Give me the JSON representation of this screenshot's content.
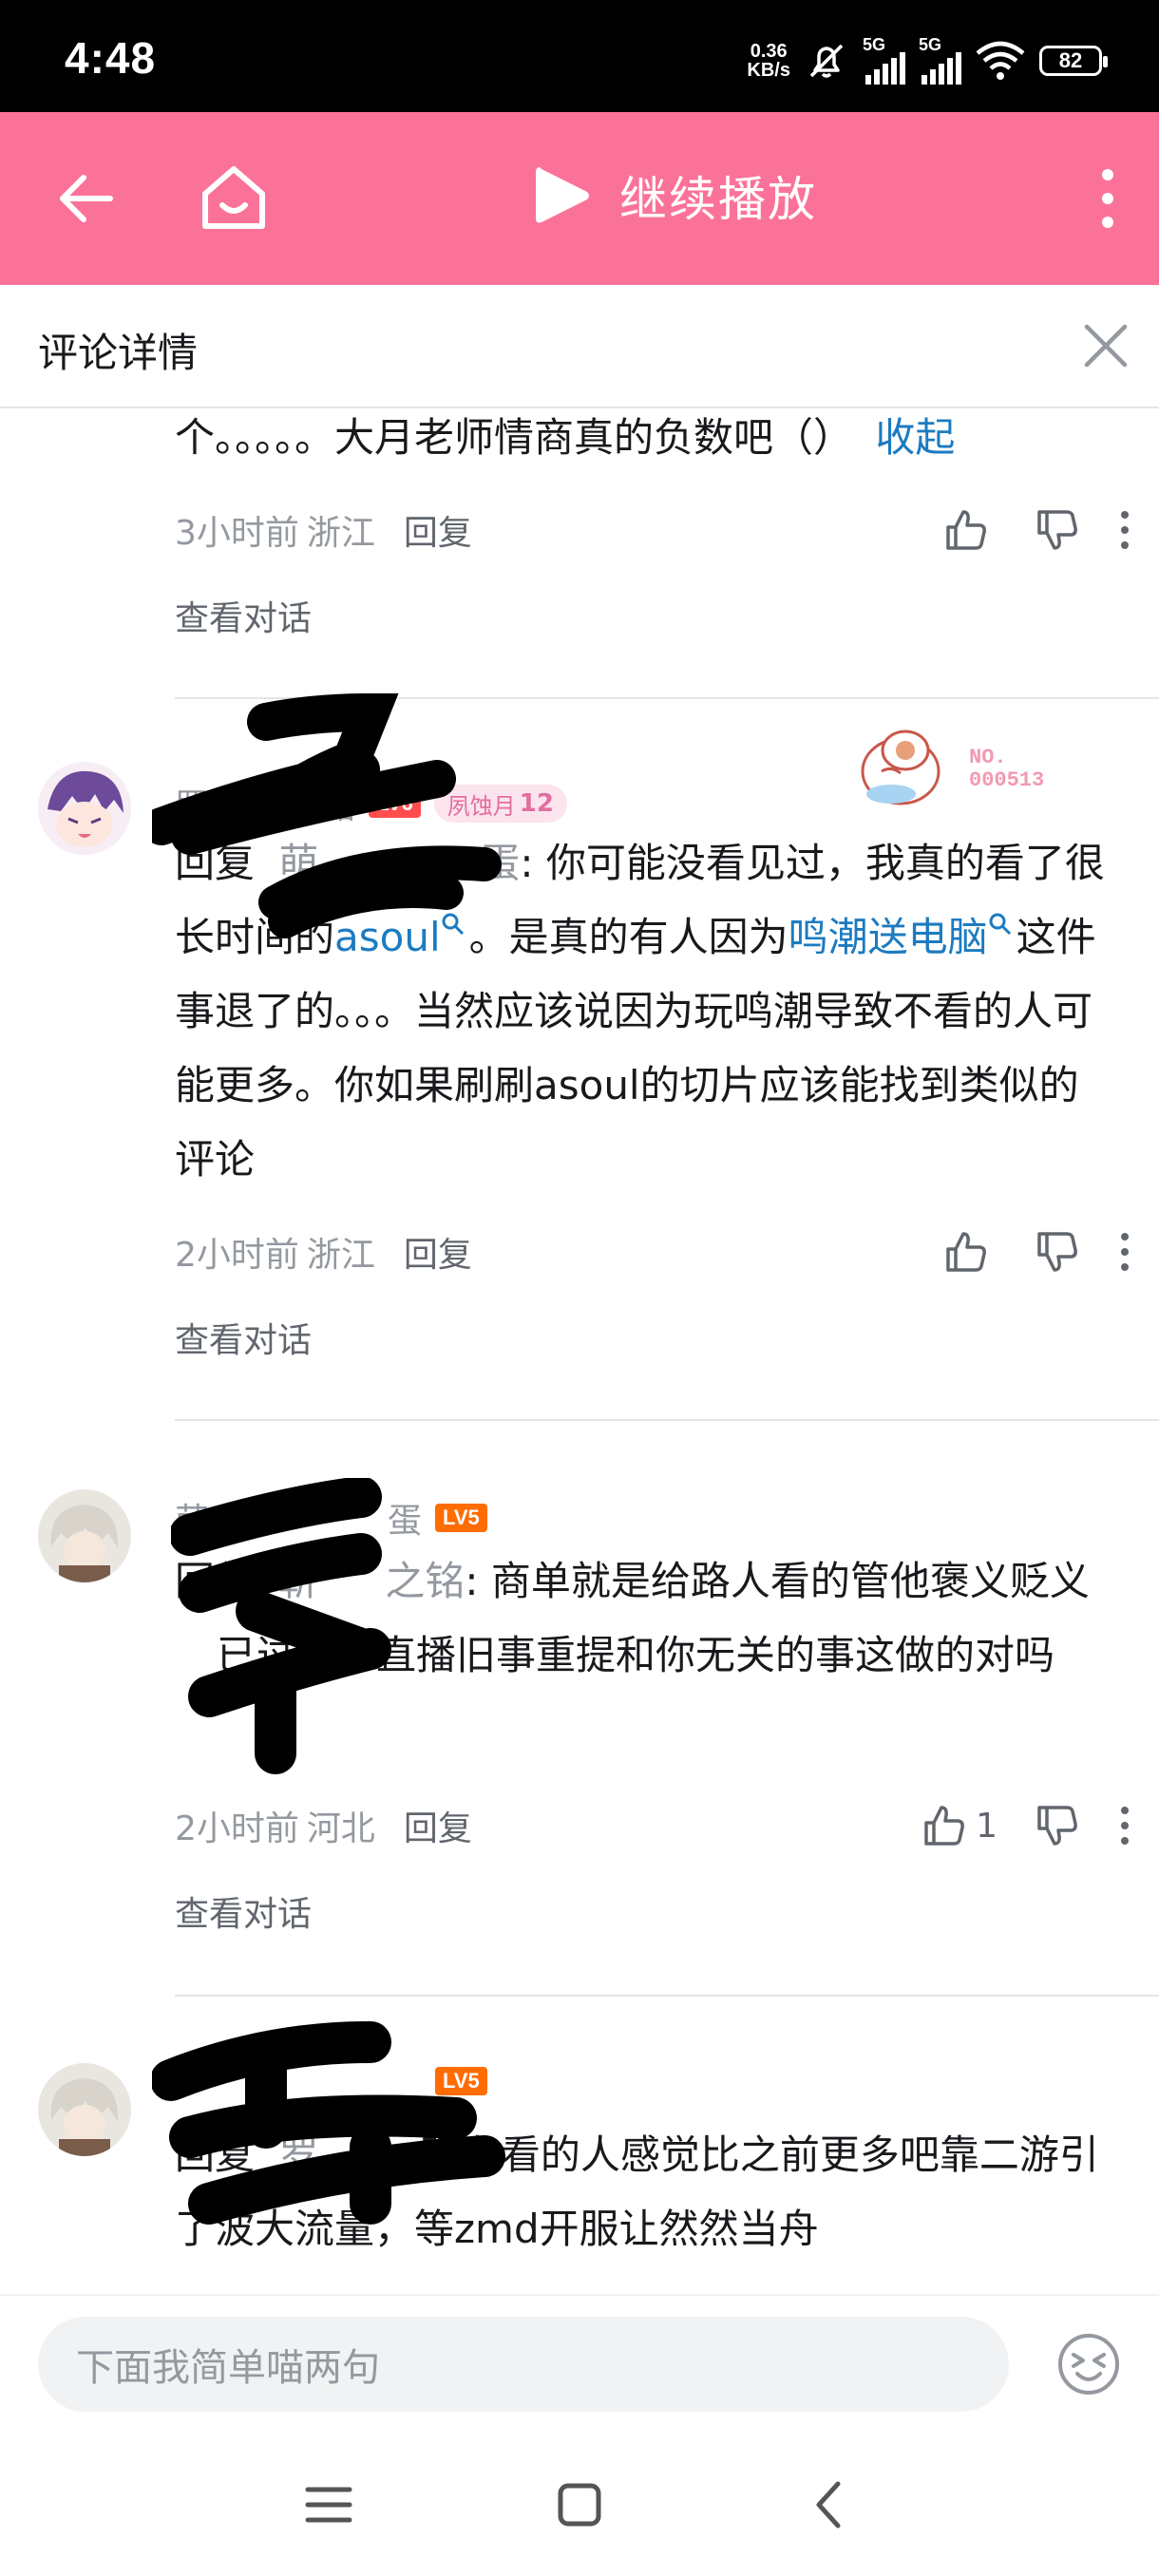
{
  "status_bar": {
    "time": "4:48",
    "net_speed_value": "0.36",
    "net_speed_unit": "KB/s",
    "sim1": "5G",
    "sim2": "5G",
    "battery": "82"
  },
  "header": {
    "play_label": "继续播放",
    "accent_color": "#fb7299"
  },
  "panel": {
    "title": "评论详情"
  },
  "comments": [
    {
      "text_tail": "个。。。。。大月老师情商真的负数吧（）",
      "collapse_label": "收起",
      "time": "3小时前",
      "location": "浙江",
      "reply_label": "回复",
      "likes": "",
      "view_conversation": "查看对话"
    },
    {
      "username_visible_prefix": "罗",
      "username_visible_suffix": "铭",
      "level_badge": "LV6",
      "fan_badge_name": "夙蚀月",
      "fan_badge_level": "12",
      "reply_prefix": "回复",
      "reply_target_visible_a": "萌",
      "reply_target_visible_b": "蛋",
      "text_a": ": 你可能没看见过，我真的看了很长时间的",
      "link_1": "asoul",
      "text_b": "。是真的有人因为",
      "link_2": "鸣潮送电脑",
      "text_c": "这件事退了的。。。当然应该说因为玩鸣潮导致不看的人可能更多。你如果刷刷asoul的切片应该能找到类似的评论",
      "time": "2小时前",
      "location": "浙江",
      "reply_label": "回复",
      "likes": "",
      "view_conversation": "查看对话",
      "sticker_text_1": "NO.",
      "sticker_text_2": "000513"
    },
    {
      "username_visible_prefix": "萌",
      "username_visible_suffix": "蛋",
      "level_badge": "LV5",
      "reply_prefix": "回复",
      "reply_target_visible_a": "靳",
      "reply_target_visible_b": "之铭",
      "text_a": ": 商单就是给路人看的管他褒义贬义",
      "text_b": "已过去了直播旧事重提和你无关的事这做的对吗",
      "time": "2小时前",
      "location": "河北",
      "reply_label": "回复",
      "likes": "1",
      "view_conversation": "查看对话"
    },
    {
      "level_badge": "LV5",
      "reply_prefix": "回复",
      "reply_target_visible_a": "罗",
      "text_a": ": 现在看的人感觉比之前更多吧靠二游引了波大流量，等zmd开服让然然当舟"
    }
  ],
  "input": {
    "placeholder": "下面我简单喵两句"
  }
}
